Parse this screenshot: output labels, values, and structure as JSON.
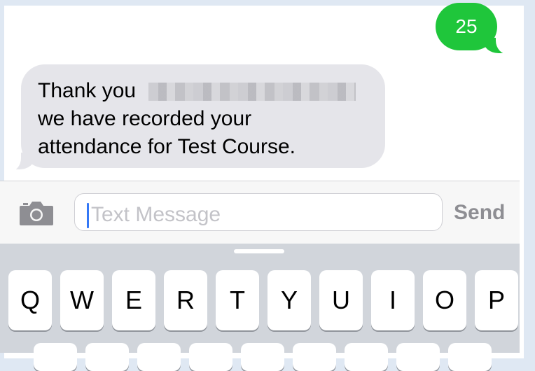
{
  "conversation": {
    "sent": {
      "text": "25"
    },
    "received": {
      "line1": "Thank you",
      "line2": "we have recorded your",
      "line3": "attendance for Test Course."
    }
  },
  "compose": {
    "placeholder": "Text Message",
    "send_label": "Send",
    "camera_icon": "camera-icon"
  },
  "keyboard": {
    "row1": [
      "Q",
      "W",
      "E",
      "R",
      "T",
      "Y",
      "U",
      "I",
      "O",
      "P"
    ]
  },
  "colors": {
    "sent_bubble": "#1fc63b",
    "received_bubble": "#e5e5ea",
    "caret": "#3478f6",
    "keyboard_bg": "#d1d5db"
  }
}
